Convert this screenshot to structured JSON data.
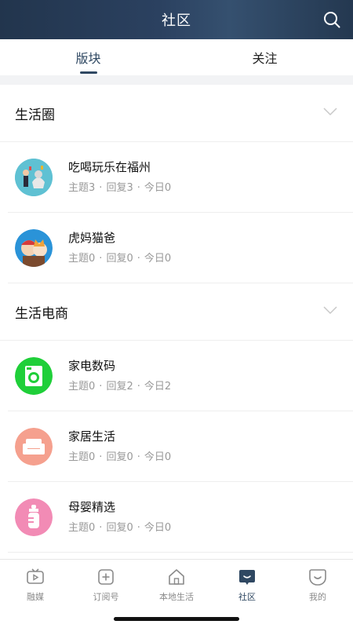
{
  "header": {
    "title": "社区",
    "search_icon": "search-icon"
  },
  "tabs": [
    {
      "label": "版块",
      "active": true
    },
    {
      "label": "关注",
      "active": false
    }
  ],
  "sections": [
    {
      "title": "生活圈",
      "items": [
        {
          "name": "吃喝玩乐在福州",
          "topics_label": "主题",
          "topics": "3",
          "replies_label": "回复",
          "replies": "3",
          "today_label": "今日",
          "today": "0",
          "avatar_color": "#5fc1d3"
        },
        {
          "name": "虎妈猫爸",
          "topics_label": "主题",
          "topics": "0",
          "replies_label": "回复",
          "replies": "0",
          "today_label": "今日",
          "today": "0",
          "avatar_color": "#2a93d8"
        }
      ]
    },
    {
      "title": "生活电商",
      "items": [
        {
          "name": "家电数码",
          "topics_label": "主题",
          "topics": "0",
          "replies_label": "回复",
          "replies": "2",
          "today_label": "今日",
          "today": "2",
          "avatar_color": "#1fcf39"
        },
        {
          "name": "家居生活",
          "topics_label": "主题",
          "topics": "0",
          "replies_label": "回复",
          "replies": "0",
          "today_label": "今日",
          "today": "0",
          "avatar_color": "#f5a08e"
        },
        {
          "name": "母婴精选",
          "topics_label": "主题",
          "topics": "0",
          "replies_label": "回复",
          "replies": "0",
          "today_label": "今日",
          "today": "0",
          "avatar_color": "#f28bb5"
        }
      ]
    }
  ],
  "bottom_nav": [
    {
      "label": "融媒",
      "icon": "tv-icon",
      "active": false
    },
    {
      "label": "订阅号",
      "icon": "plus-square-icon",
      "active": false
    },
    {
      "label": "本地生活",
      "icon": "home-icon",
      "active": false
    },
    {
      "label": "社区",
      "icon": "chat-icon",
      "active": true
    },
    {
      "label": "我的",
      "icon": "smile-icon",
      "active": false
    }
  ],
  "colors": {
    "accent": "#2f4862",
    "header_bg": "#2b4160",
    "muted": "#999999"
  }
}
